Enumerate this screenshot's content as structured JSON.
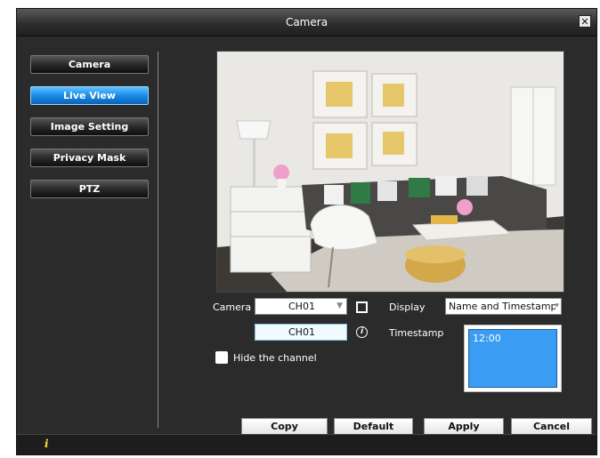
{
  "window": {
    "title": "Camera",
    "close_glyph": "✕"
  },
  "sidebar": {
    "items": [
      {
        "label": "Camera",
        "active": false
      },
      {
        "label": "Live View",
        "active": true
      },
      {
        "label": "Image Setting",
        "active": false
      },
      {
        "label": "Privacy Mask",
        "active": false
      },
      {
        "label": "PTZ",
        "active": false
      }
    ]
  },
  "form": {
    "camera_label": "Camera",
    "camera_value": "CH01",
    "display_label": "Display",
    "display_value": "Name and Timestamp",
    "channel_name_value": "CH01",
    "timestamp_label": "Timestamp",
    "timestamp_preview_text": "12:00",
    "hide_channel_label": "Hide the channel"
  },
  "buttons": {
    "copy": "Copy",
    "default": "Default",
    "apply": "Apply",
    "cancel": "Cancel"
  },
  "statusbar": {
    "info_glyph": "i"
  },
  "colors": {
    "accent": "#1b8be6",
    "timestamp_bg": "#3a9cf2",
    "status_icon": "#f3e33a"
  },
  "icons": [
    "close-icon",
    "dropdown-arrow-icon",
    "info-icon",
    "checkbox-icon"
  ]
}
